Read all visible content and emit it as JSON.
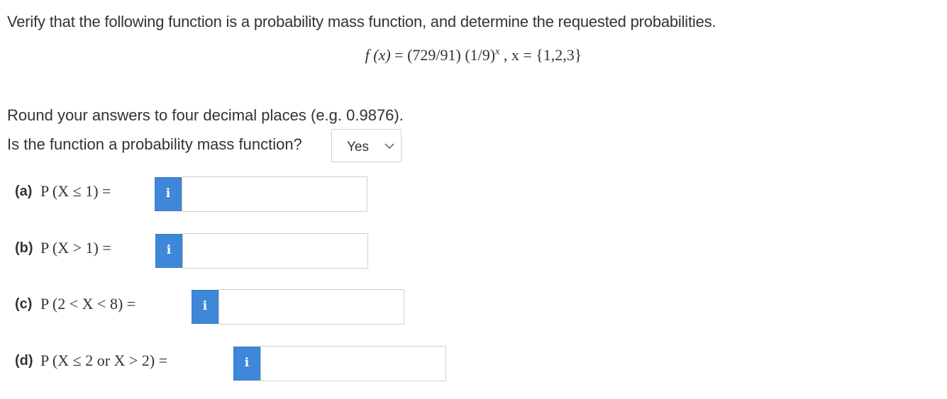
{
  "question": {
    "intro": "Verify that the following function is a probability mass function, and determine the requested probabilities.",
    "formula": {
      "lhs": "f (x)",
      "eq": "=",
      "rhs": "(729/91) (1/9)",
      "exponent": "x",
      "domain": ", x = {1,2,3}"
    },
    "round_note": "Round your answers to four decimal places (e.g. 0.9876).",
    "pmf_question": "Is the function a probability mass function?",
    "pmf_select": {
      "selected": "Yes"
    }
  },
  "parts": [
    {
      "label": "(a)",
      "expr": "P (X ≤ 1) =",
      "info": "i",
      "value": ""
    },
    {
      "label": "(b)",
      "expr": "P (X > 1) =",
      "info": "i",
      "value": ""
    },
    {
      "label": "(c)",
      "expr": "P (2 < X < 8) =",
      "info": "i",
      "value": ""
    },
    {
      "label": "(d)",
      "expr": "P (X ≤ 2 or X > 2) =",
      "info": "i",
      "value": ""
    }
  ],
  "colors": {
    "info_button": "#3f87d9",
    "text": "#333333",
    "input_border": "#cfcfcf"
  }
}
